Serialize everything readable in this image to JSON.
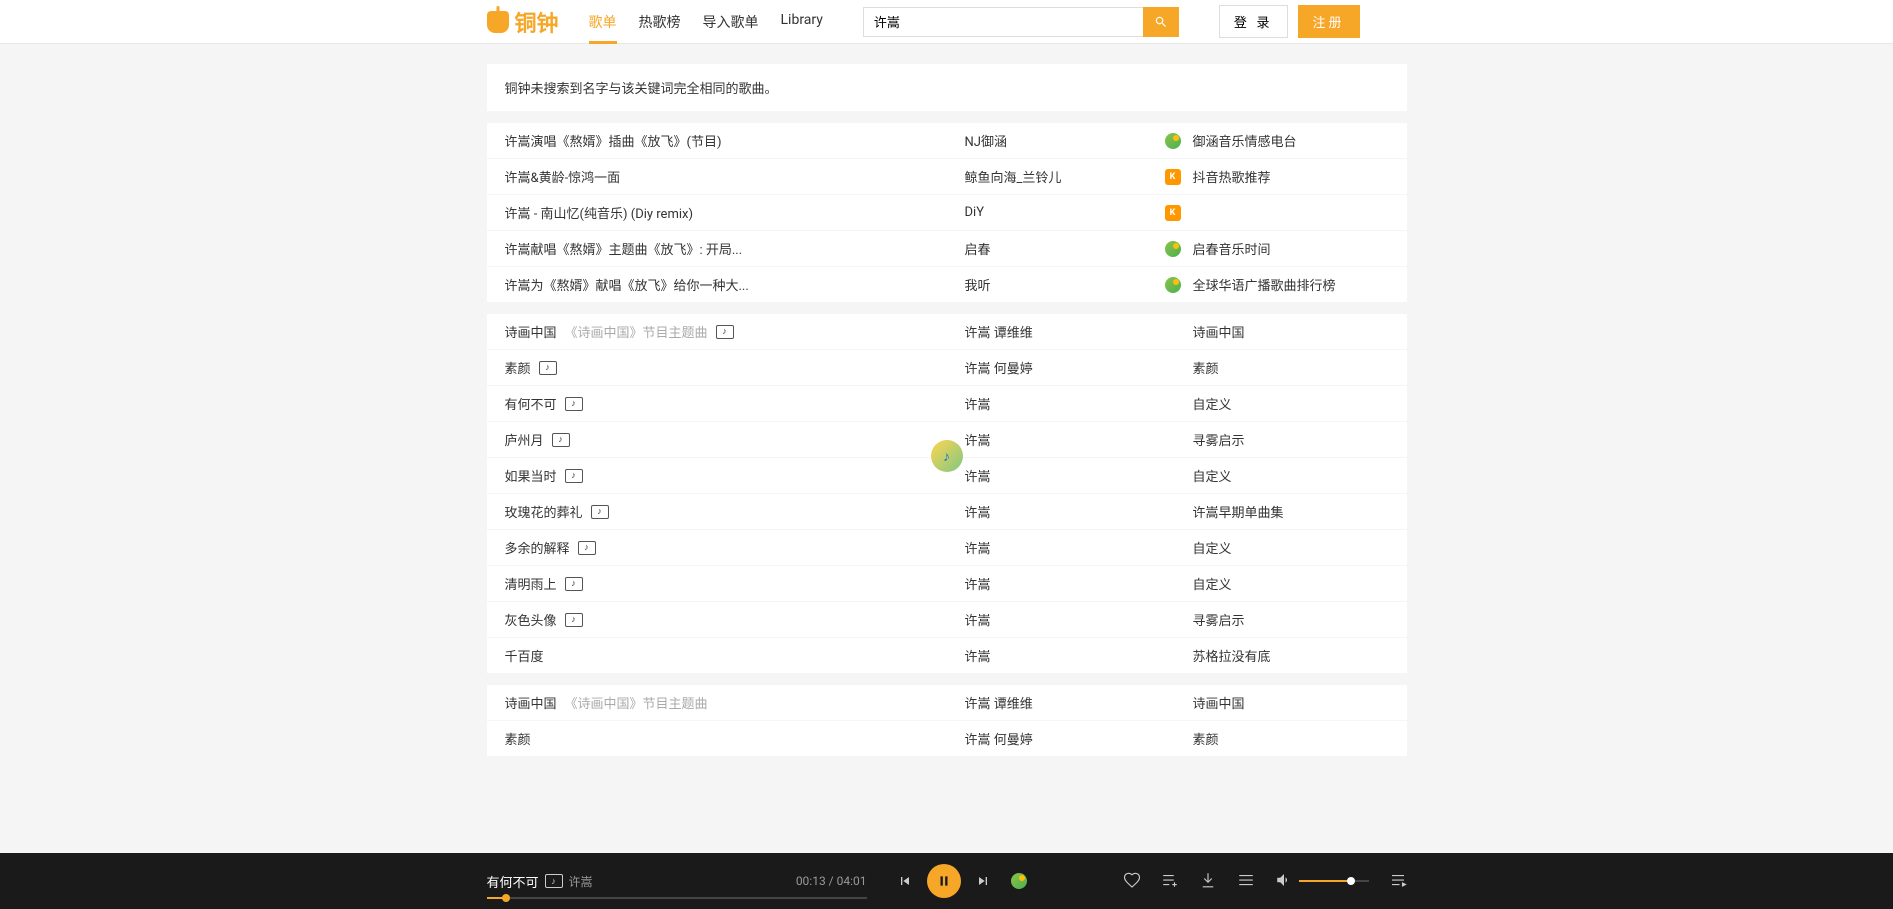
{
  "brand": "铜钟",
  "nav": {
    "playlists": "歌单",
    "hot": "热歌榜",
    "import": "导入歌单",
    "library": "Library"
  },
  "search": {
    "value": "许嵩"
  },
  "auth": {
    "login": "登 录",
    "register": "注册"
  },
  "notice": "铜钟未搜索到名字与该关键词完全相同的歌曲。",
  "panel1": [
    {
      "title": "许嵩演唱《熬婿》插曲《放飞》(节目)",
      "artist": "NJ御涵",
      "src": "green",
      "album": "御涵音乐情感电台"
    },
    {
      "title": "许嵩&黄龄-惊鸿一面",
      "artist": "鲸鱼向海_兰铃儿",
      "src": "orange",
      "album": "抖音热歌推荐"
    },
    {
      "title": "许嵩 - 南山忆(纯音乐)   (Diy remix)",
      "artist": "DiY",
      "src": "orange",
      "album": ""
    },
    {
      "title": "许嵩献唱《熬婿》主题曲《放飞》:  开局...",
      "artist": "启春",
      "src": "green",
      "album": "启春音乐时间"
    },
    {
      "title": "许嵩为《熬婿》献唱《放飞》给你一种大...",
      "artist": "我听",
      "src": "green",
      "album": "全球华语广播歌曲排行榜"
    }
  ],
  "panel2": [
    {
      "title": "诗画中国",
      "sub": "《诗画中国》节目主题曲",
      "mv": true,
      "artist": "许嵩  谭维维",
      "album": "诗画中国"
    },
    {
      "title": "素颜",
      "mv": true,
      "artist": "许嵩  何曼婷",
      "album": "素颜"
    },
    {
      "title": "有何不可",
      "mv": true,
      "artist": "许嵩",
      "album": "自定义"
    },
    {
      "title": "庐州月",
      "mv": true,
      "artist": "许嵩",
      "album": "寻雾启示"
    },
    {
      "title": "如果当时",
      "mv": true,
      "artist": "许嵩",
      "album": "自定义"
    },
    {
      "title": "玫瑰花的葬礼",
      "mv": true,
      "artist": "许嵩",
      "album": "许嵩早期单曲集"
    },
    {
      "title": "多余的解释",
      "mv": true,
      "artist": "许嵩",
      "album": "自定义"
    },
    {
      "title": "清明雨上",
      "mv": true,
      "artist": "许嵩",
      "album": "自定义"
    },
    {
      "title": "灰色头像",
      "mv": true,
      "artist": "许嵩",
      "album": "寻雾启示"
    },
    {
      "title": "千百度",
      "artist": "许嵩",
      "album": "苏格拉没有底"
    }
  ],
  "panel3": [
    {
      "title": "诗画中国",
      "sub": "《诗画中国》节目主题曲",
      "artist": "许嵩  谭维维",
      "album": "诗画中国"
    },
    {
      "title": "素颜",
      "artist": "许嵩  何曼婷",
      "album": "素颜"
    }
  ],
  "player": {
    "title": "有何不可",
    "artist": "许嵩",
    "elapsed": "00:13",
    "total": "04:01"
  }
}
